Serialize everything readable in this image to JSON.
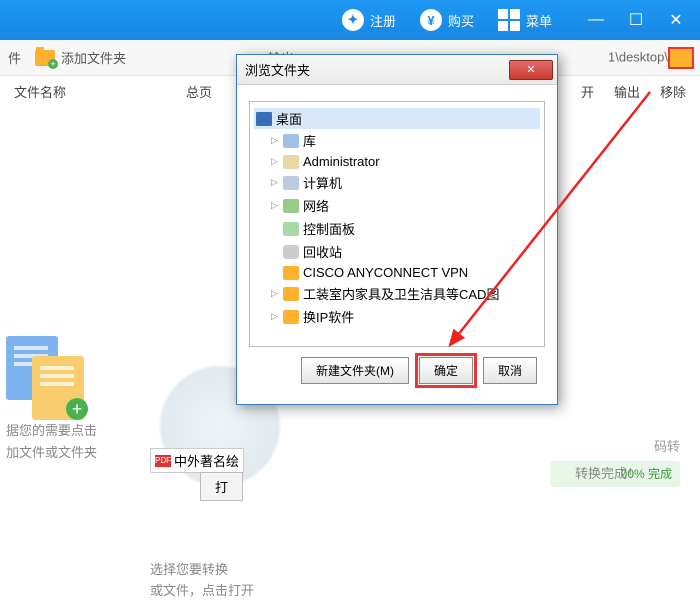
{
  "topbar": {
    "register": "注册",
    "buy": "购买",
    "menu": "菜单"
  },
  "toolbar": {
    "file": "件",
    "add_folder": "添加文件夹",
    "output_prefix": "输出",
    "path_tail": "1\\desktop\\"
  },
  "columns": {
    "name": "文件名称",
    "pages": "总页",
    "open": "开",
    "export": "输出",
    "remove": "移除"
  },
  "bg": {
    "drop_hint_l1": "据您的需要点击",
    "drop_hint_l2": "加文件或文件夹",
    "mid_file": "中外著名绘",
    "open": "打",
    "hint2_l1": "选择您要转换",
    "hint2_l2": "或文件，点击打开",
    "pct": "00% 完成",
    "done": "转换完成！",
    "code_hint": "码转"
  },
  "dialog": {
    "title": "浏览文件夹",
    "root": "桌面",
    "items": [
      {
        "label": "库",
        "icon": "lib"
      },
      {
        "label": "Administrator",
        "icon": "user"
      },
      {
        "label": "计算机",
        "icon": "comp"
      },
      {
        "label": "网络",
        "icon": "net"
      },
      {
        "label": "控制面板",
        "icon": "panel"
      },
      {
        "label": "回收站",
        "icon": "bin"
      },
      {
        "label": "CISCO ANYCONNECT VPN",
        "icon": "folder"
      },
      {
        "label": "工装室内家具及卫生洁具等CAD图",
        "icon": "folder"
      },
      {
        "label": "换IP软件",
        "icon": "folder"
      }
    ],
    "new_folder": "新建文件夹(M)",
    "ok": "确定",
    "cancel": "取消"
  }
}
